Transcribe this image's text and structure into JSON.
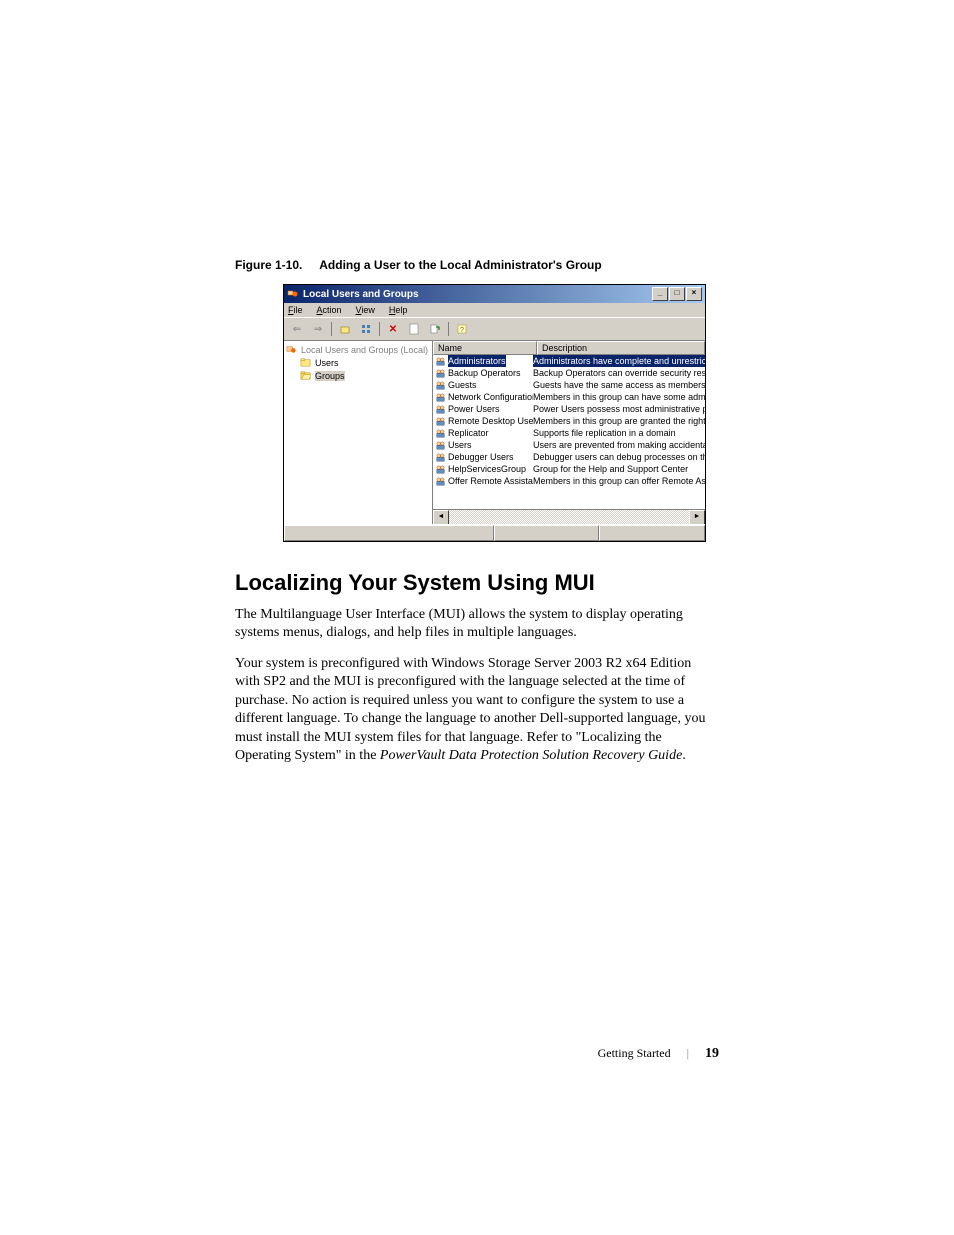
{
  "figure": {
    "number": "Figure 1-10.",
    "title": "Adding a User to the Local Administrator's Group"
  },
  "window": {
    "title": "Local Users and Groups",
    "menus": {
      "file": "File",
      "action": "Action",
      "view": "View",
      "help": "Help"
    },
    "tree": {
      "root": "Local Users and Groups (Local)",
      "users": "Users",
      "groups": "Groups"
    },
    "columns": {
      "name": "Name",
      "description": "Description"
    },
    "rows": [
      {
        "name": "Administrators",
        "desc": "Administrators have complete and unrestricted",
        "selected": true
      },
      {
        "name": "Backup Operators",
        "desc": "Backup Operators can override security restricti"
      },
      {
        "name": "Guests",
        "desc": "Guests have the same access as members of th"
      },
      {
        "name": "Network Configuration ...",
        "desc": "Members in this group can have some administr"
      },
      {
        "name": "Power Users",
        "desc": "Power Users possess most administrative powe"
      },
      {
        "name": "Remote Desktop Users",
        "desc": "Members in this group are granted the right to"
      },
      {
        "name": "Replicator",
        "desc": "Supports file replication in a domain"
      },
      {
        "name": "Users",
        "desc": "Users are prevented from making accidental or"
      },
      {
        "name": "Debugger Users",
        "desc": "Debugger users can debug processes on this m"
      },
      {
        "name": "HelpServicesGroup",
        "desc": "Group for the Help and Support Center"
      },
      {
        "name": "Offer Remote Assistanc...",
        "desc": "Members in this group can offer Remote Assist."
      }
    ]
  },
  "heading": "Localizing Your System Using MUI",
  "para1": "The Multilanguage User Interface (MUI) allows the system to display operating systems menus, dialogs, and help files in multiple languages.",
  "para2_a": "Your system is preconfigured with Windows Storage Server 2003 R2 x64 Edition with SP2 and the MUI is preconfigured with the language selected at the time of purchase. No action is required unless you want to configure the system to use a different language. To change the language to another Dell-supported language, you must install the MUI system files for that language. Refer to \"Localizing the Operating System\" in the ",
  "para2_italic": "PowerVault Data Protection Solution Recovery Guide",
  "para2_b": ".",
  "footer": {
    "section": "Getting Started",
    "page": "19"
  },
  "icons": {
    "back": "⇐",
    "fwd": "⇒",
    "up": "⬆",
    "props": "☰",
    "del": "✕",
    "refresh": "⟳",
    "help": "?"
  }
}
